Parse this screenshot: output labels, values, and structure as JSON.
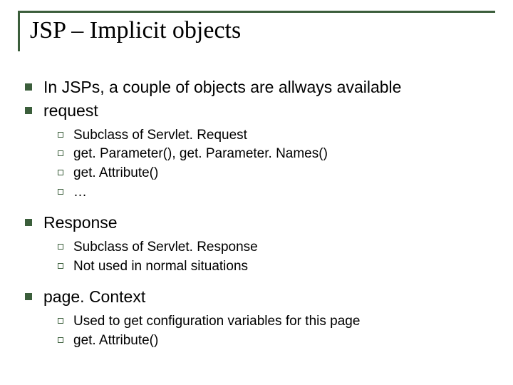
{
  "title": "JSP – Implicit objects",
  "bullets": {
    "b1": "In JSPs, a couple of objects are allways available",
    "b2": "request",
    "b2_sub": {
      "s1": "Subclass of Servlet. Request",
      "s2": "get. Parameter(), get. Parameter. Names()",
      "s3": "get. Attribute()",
      "s4": "…"
    },
    "b3": "Response",
    "b3_sub": {
      "s1": "Subclass of Servlet. Response",
      "s2": "Not used in normal situations"
    },
    "b4": "page. Context",
    "b4_sub": {
      "s1": "Used to get configuration variables for this page",
      "s2": "get. Attribute()"
    }
  }
}
